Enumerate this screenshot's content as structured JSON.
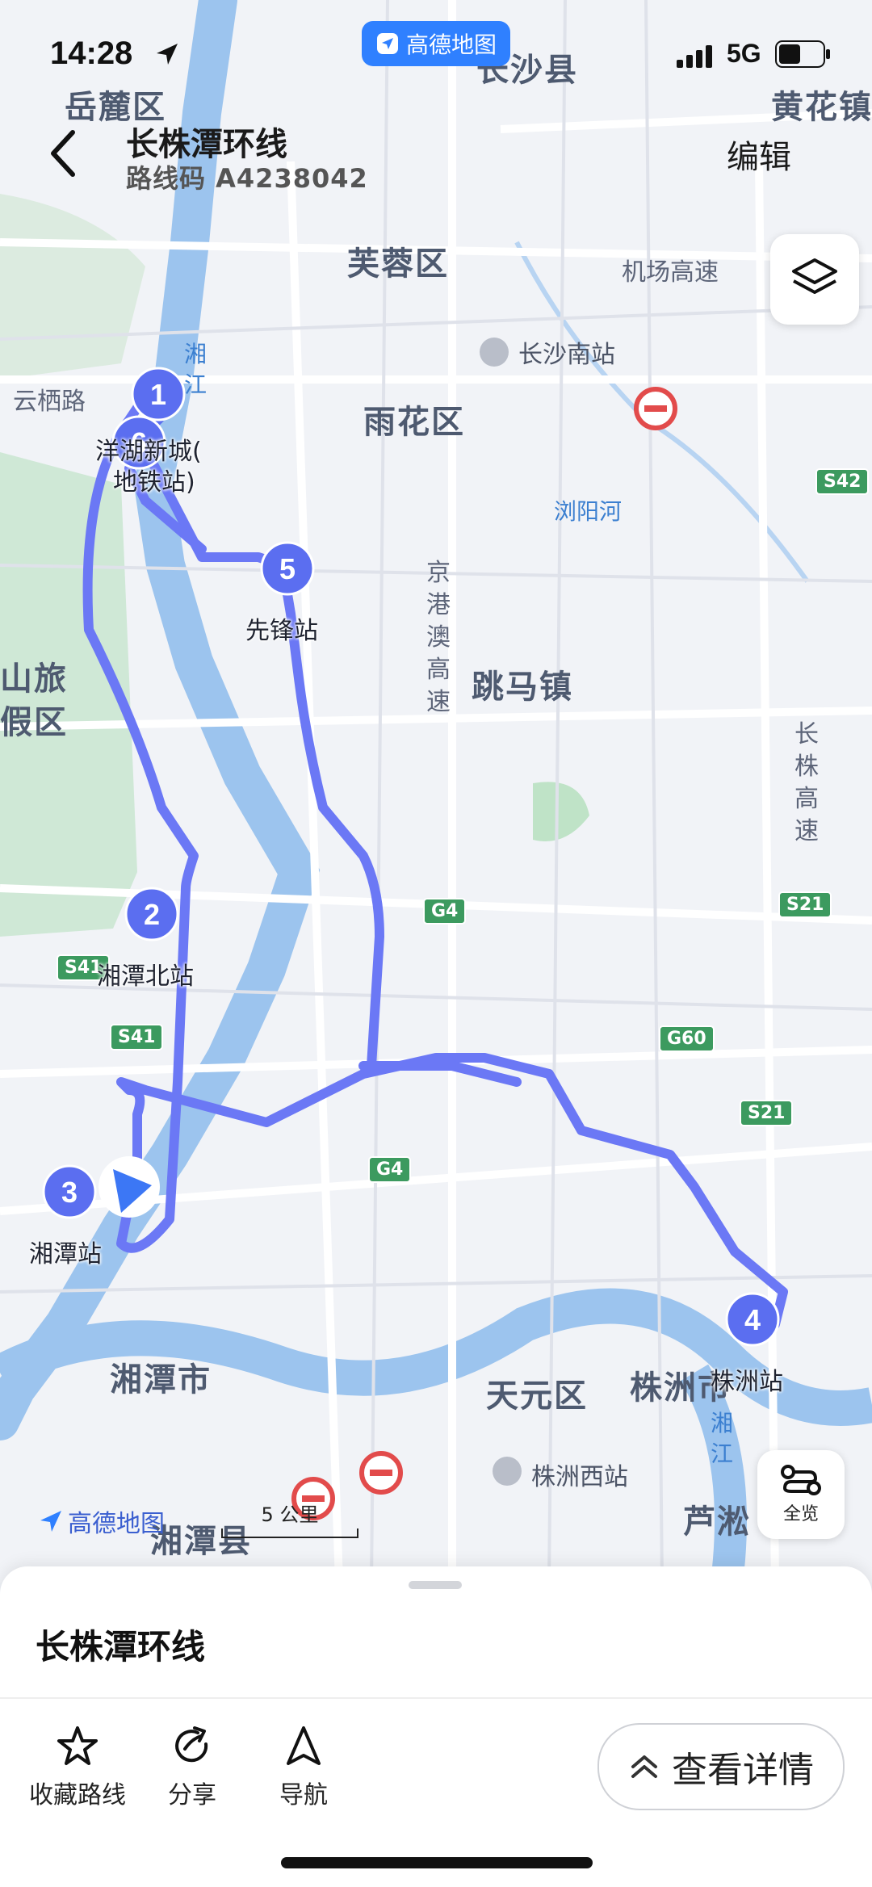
{
  "status_bar": {
    "time": "14:28",
    "network": "5G",
    "app_pill": "高德地图"
  },
  "header": {
    "title": "长株潭环线",
    "route_code": "路线码 A4238042",
    "edit_label": "编辑"
  },
  "map": {
    "districts": [
      "岳麓区",
      "长沙县",
      "黄花镇",
      "芙蓉区",
      "雨花区",
      "跳马镇",
      "湘潭市",
      "天元区",
      "株洲市",
      "芦淞",
      "湘潭县",
      "山旅",
      "假区"
    ],
    "roads": [
      "机场高速",
      "云栖路",
      "京港澳高速",
      "长株高速"
    ],
    "rivers": [
      "湘江",
      "浏阳河",
      "湘江"
    ],
    "stations": [
      "长沙南站",
      "株洲西站"
    ],
    "road_badges": [
      "G4",
      "G4",
      "G60",
      "S21",
      "S21",
      "S41",
      "S41",
      "S42"
    ],
    "stops": [
      {
        "number": "1",
        "name": ""
      },
      {
        "number": "2",
        "name": "湘潭北站"
      },
      {
        "number": "3",
        "name": "湘潭站"
      },
      {
        "number": "4",
        "name": "株洲站"
      },
      {
        "number": "5",
        "name": "先锋站"
      },
      {
        "number": "6",
        "name": "洋湖新城(地铁站)"
      }
    ],
    "stop6_line1": "洋湖新城(",
    "stop6_line2": "地铁站)",
    "scale_label": "5 公里",
    "logo_text": "高德地图",
    "overview_label": "全览"
  },
  "sheet": {
    "title": "长株潭环线",
    "actions": {
      "favorite": "收藏路线",
      "share": "分享",
      "navigate": "导航"
    },
    "details_label": "查看详情"
  },
  "colors": {
    "route": "#6b78f5",
    "marker": "#5b6ef0",
    "brand": "#2f80ff"
  }
}
